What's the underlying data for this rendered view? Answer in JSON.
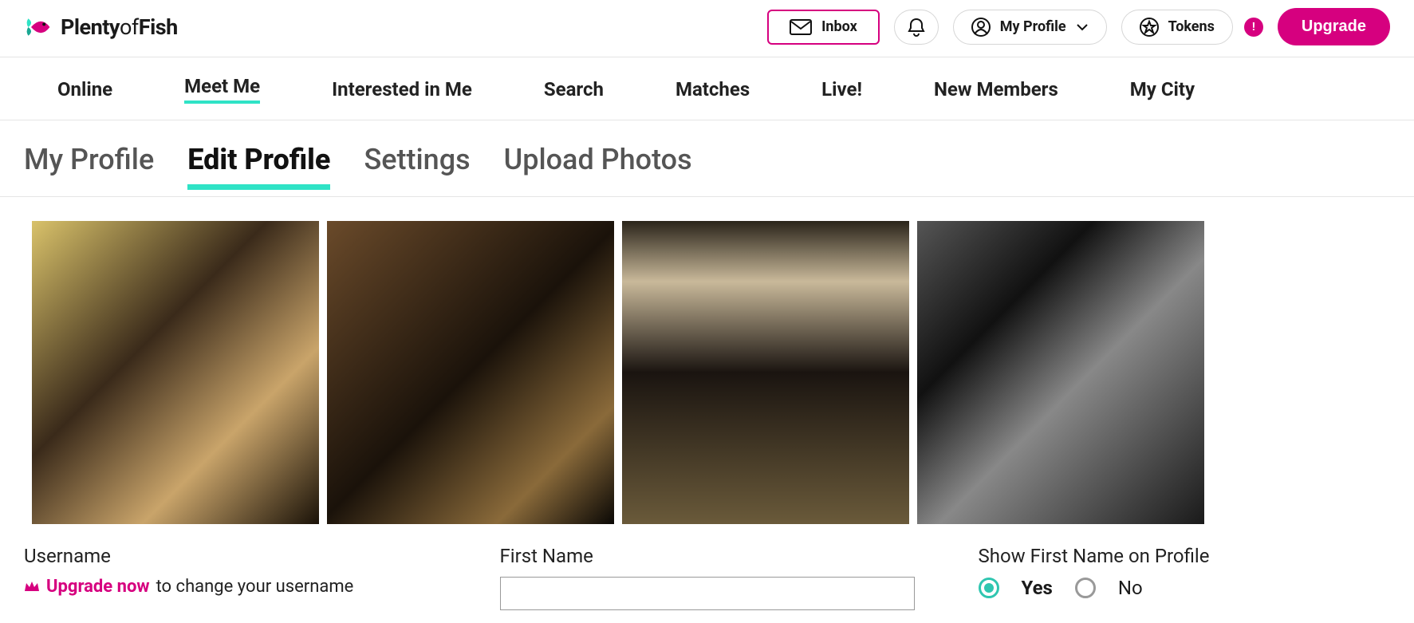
{
  "brand": {
    "name_bold1": "Plenty",
    "name_light": "of",
    "name_bold2": "Fish"
  },
  "topbar": {
    "inbox": "Inbox",
    "my_profile": "My Profile",
    "tokens": "Tokens",
    "alert_badge": "!",
    "upgrade": "Upgrade"
  },
  "mainnav": {
    "items": [
      {
        "label": "Online"
      },
      {
        "label": "Meet Me"
      },
      {
        "label": "Interested in Me"
      },
      {
        "label": "Search"
      },
      {
        "label": "Matches"
      },
      {
        "label": "Live!"
      },
      {
        "label": "New Members"
      },
      {
        "label": "My City"
      }
    ],
    "active_index": 1
  },
  "subtabs": {
    "items": [
      {
        "label": "My Profile"
      },
      {
        "label": "Edit Profile"
      },
      {
        "label": "Settings"
      },
      {
        "label": "Upload Photos"
      }
    ],
    "active_index": 1
  },
  "form": {
    "username_label": "Username",
    "upgrade_link": "Upgrade now",
    "upgrade_rest": " to change your username",
    "firstname_label": "First Name",
    "showname_label": "Show First Name on Profile",
    "opt_yes": "Yes",
    "opt_no": "No"
  },
  "colors": {
    "accent_pink": "#d6007f",
    "accent_teal": "#2fe3c6"
  }
}
